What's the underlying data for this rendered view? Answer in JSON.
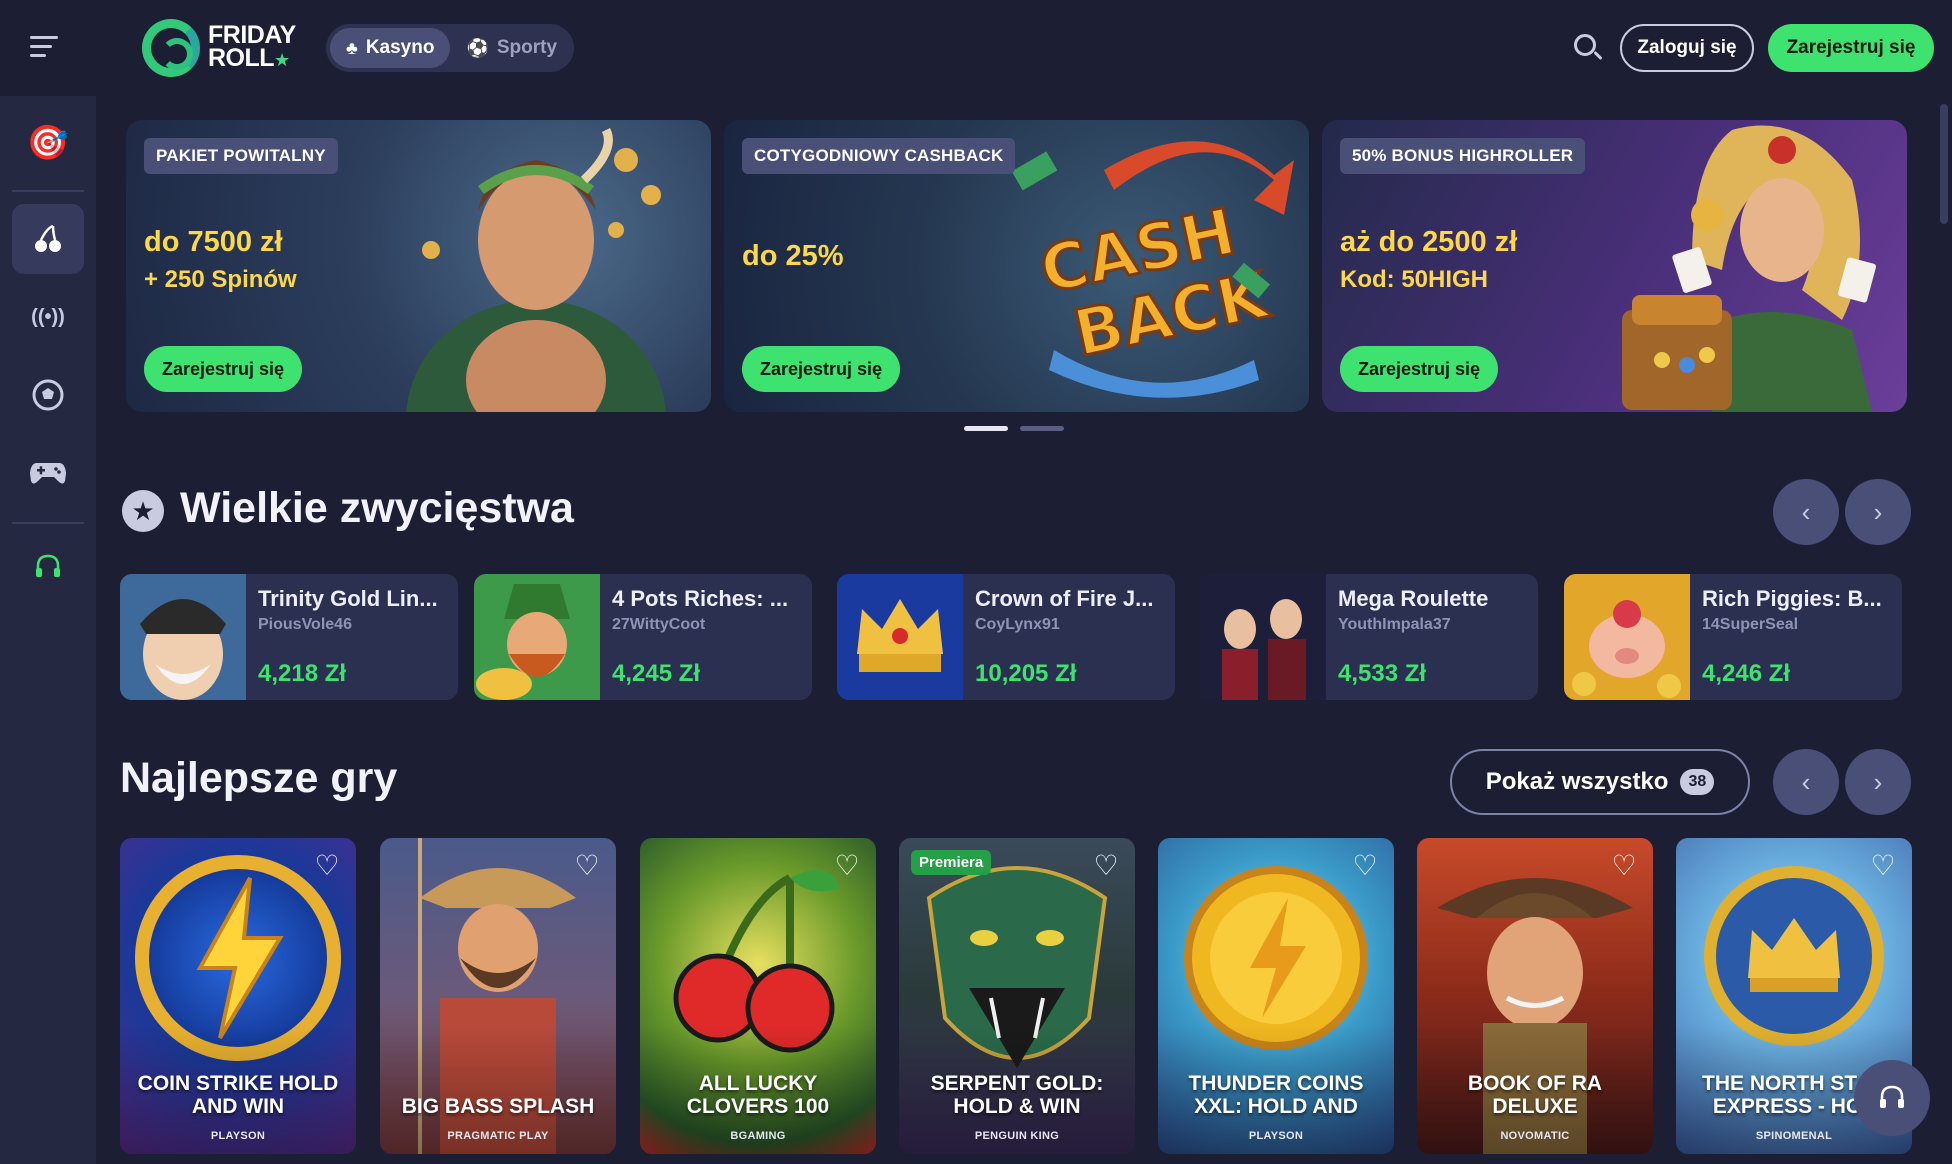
{
  "brand": {
    "line1": "FRIDAY",
    "line2": "ROLL",
    "star": "★"
  },
  "header": {
    "tabs": [
      {
        "label": "Kasyno",
        "icon": "cherry-icon",
        "active": true
      },
      {
        "label": "Sporty",
        "icon": "soccer-ball-icon",
        "active": false
      }
    ],
    "login_label": "Zaloguj się",
    "register_label": "Zarejestruj się",
    "accent_color": "#3ee36f"
  },
  "sidebar": {
    "items": [
      {
        "name": "promotions",
        "icon": "dart-target-icon",
        "glyph": "🎯"
      },
      {
        "name": "casino",
        "icon": "cherry-icon",
        "glyph": "🍒"
      },
      {
        "name": "live",
        "icon": "live-broadcast-icon",
        "glyph": "((•))"
      },
      {
        "name": "sports",
        "icon": "soccer-ball-icon",
        "glyph": "⚽"
      },
      {
        "name": "games",
        "icon": "gamepad-icon",
        "glyph": "🎮"
      },
      {
        "name": "support",
        "icon": "headset-icon",
        "glyph": "🎧"
      }
    ]
  },
  "banners": [
    {
      "tag": "PAKIET POWITALNY",
      "amount": "do 7500 zł",
      "sub": "+ 250 Spinów",
      "cta": "Zarejestruj się"
    },
    {
      "tag": "COTYGODNIOWY CASHBACK",
      "amount": "do 25%",
      "sub": "",
      "cta": "Zarejestruj się"
    },
    {
      "tag": "50% BONUS HIGHROLLER",
      "amount": "aż do 2500 zł",
      "sub": "Kod: 50HIGH",
      "cta": "Zarejestruj się"
    }
  ],
  "big_wins": {
    "title": "Wielkie zwycięstwa",
    "items": [
      {
        "game": "Trinity Gold Lin...",
        "user": "PiousVole46",
        "amount": "4,218 Zł"
      },
      {
        "game": "4 Pots Riches: ...",
        "user": "27WittyCoot",
        "amount": "4,245 Zł"
      },
      {
        "game": "Crown of Fire J...",
        "user": "CoyLynx91",
        "amount": "10,205 Zł"
      },
      {
        "game": "Mega Roulette",
        "user": "YouthImpala37",
        "amount": "4,533 Zł"
      },
      {
        "game": "Rich Piggies: B...",
        "user": "14SuperSeal",
        "amount": "4,246 Zł"
      }
    ]
  },
  "top_games": {
    "title": "Najlepsze gry",
    "show_all": "Pokaż wszystko",
    "count": "38",
    "items": [
      {
        "title": "COIN STRIKE HOLD AND WIN",
        "provider": "PLAYSON",
        "badge": ""
      },
      {
        "title": "BIG BASS SPLASH",
        "provider": "PRAGMATIC PLAY",
        "badge": ""
      },
      {
        "title": "ALL LUCKY CLOVERS 100",
        "provider": "BGAMING",
        "badge": ""
      },
      {
        "title": "SERPENT GOLD: HOLD & WIN",
        "provider": "PENGUIN KING",
        "badge": "Premiera"
      },
      {
        "title": "THUNDER COINS XXL: HOLD AND",
        "provider": "PLAYSON",
        "badge": ""
      },
      {
        "title": "BOOK OF RA DELUXE",
        "provider": "NOVOMATIC",
        "badge": ""
      },
      {
        "title": "THE NORTH STAR EXPRESS - HOL",
        "provider": "SPINOMENAL",
        "badge": ""
      }
    ]
  }
}
